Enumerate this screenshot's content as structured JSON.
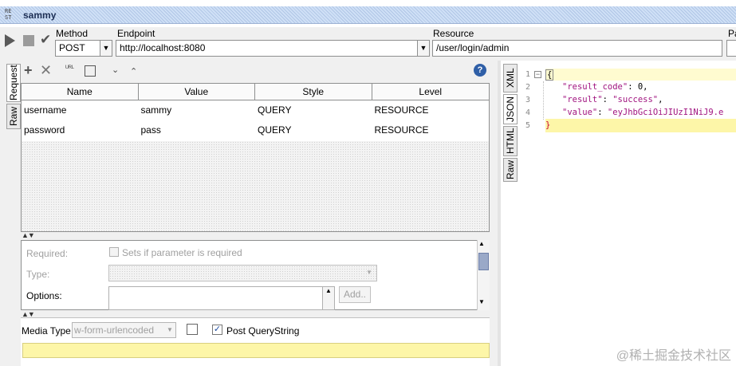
{
  "window": {
    "badge": "RE\nST",
    "title": "sammy"
  },
  "toolbar": {
    "method_label": "Method",
    "method_value": "POST",
    "endpoint_label": "Endpoint",
    "endpoint_value": "http://localhost:8080",
    "resource_label": "Resource",
    "resource_value": "/user/login/admin",
    "params_label": "Pa"
  },
  "left_tabs": [
    "Request",
    "Raw"
  ],
  "params_table": {
    "columns": [
      "Name",
      "Value",
      "Style",
      "Level"
    ],
    "rows": [
      [
        "username",
        "sammy",
        "QUERY",
        "RESOURCE"
      ],
      [
        "password",
        "pass",
        "QUERY",
        "RESOURCE"
      ]
    ]
  },
  "detail": {
    "required_label": "Required:",
    "required_checkbox": "Sets if parameter is required",
    "type_label": "Type:",
    "options_label": "Options:",
    "add_button": "Add.."
  },
  "media": {
    "label": "Media Type",
    "value": "w-form-urlencoded",
    "post_qs_label": "Post QueryString",
    "post_qs_checked": true
  },
  "right_tabs": [
    "XML",
    "JSON",
    "HTML",
    "Raw"
  ],
  "response": {
    "line_numbers": [
      "1",
      "2",
      "3",
      "4",
      "5"
    ],
    "open": "{",
    "close": "}",
    "k1": "\"result_code\"",
    "v1": " 0,",
    "k2": "\"result\"",
    "v2": "\"success\"",
    "k3": "\"value\"",
    "v3": "\"eyJhbGciOiJIUzI1NiJ9.e"
  },
  "watermark": "@稀土掘金技术社区",
  "colors": {
    "key": "#a0137f",
    "title_strip": "#cfe0f6",
    "highlight": "#fdf6a8"
  }
}
